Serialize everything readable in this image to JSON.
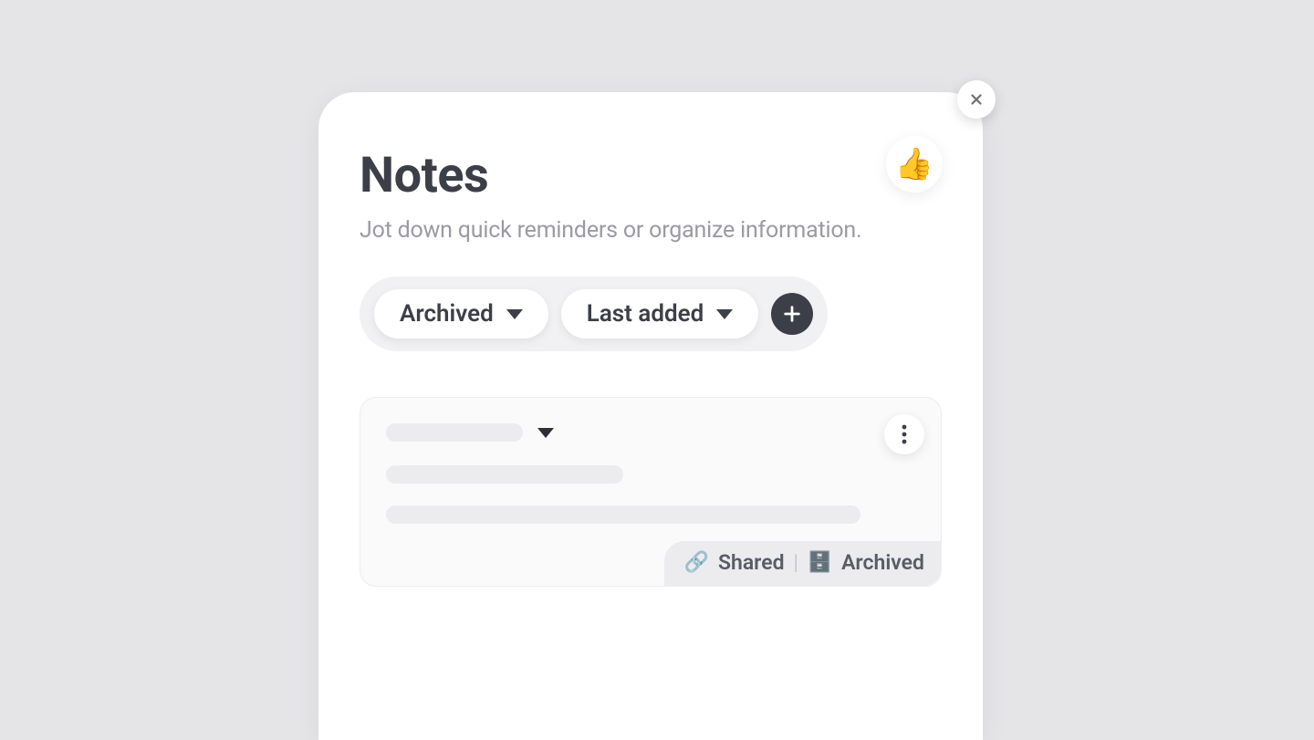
{
  "header": {
    "title": "Notes",
    "subtitle": "Jot down quick reminders or organize information.",
    "reaction_emoji": "👍"
  },
  "filters": {
    "status_label": "Archived",
    "sort_label": "Last added"
  },
  "card": {
    "badges": {
      "shared_label": "Shared",
      "archived_label": "Archived",
      "separator": "|"
    }
  }
}
